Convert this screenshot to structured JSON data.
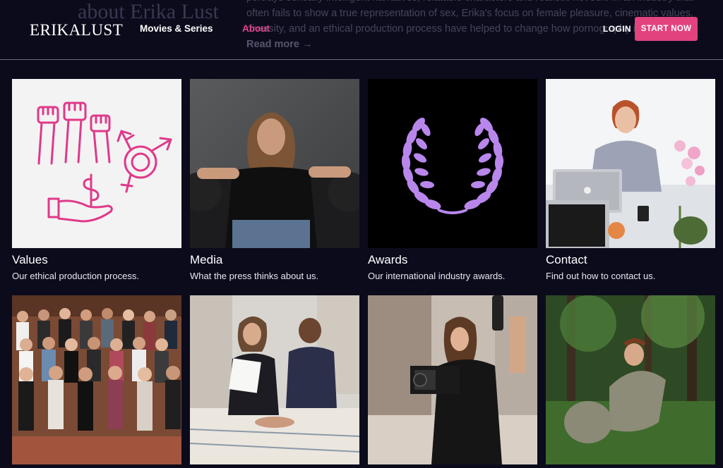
{
  "background_text": {
    "heading": "about Erika Lust",
    "paragraph": "portrays sexually intelligent narratives, relatable characters and realistic hot sex. In an industry that often fails to show a true representation of sex, Erika's focus on female pleasure, cinematic values, diversity, and an ethical production process have helped to change how pornography is consumed.",
    "read_more": "Read more →"
  },
  "header": {
    "logo": "ERIKALUST",
    "nav": [
      "Movies & Series",
      "About"
    ],
    "active_nav": "About",
    "login": "LOGIN",
    "cta": "START NOW"
  },
  "colors": {
    "background": "#0c0b1c",
    "accent": "#e2437f",
    "active_link": "#e5408c",
    "laurel": "#b987ec",
    "values_icons": "#e0398a"
  },
  "cards": [
    {
      "title": "Values",
      "subtitle": "Our ethical production process.",
      "image": "values-icons-illustration"
    },
    {
      "title": "Media",
      "subtitle": "What the press thinks about us.",
      "image": "woman-on-leather-sofa-photo"
    },
    {
      "title": "Awards",
      "subtitle": "Our international industry awards.",
      "image": "laurel-wreath-icon"
    },
    {
      "title": "Contact",
      "subtitle": "Find out how to contact us.",
      "image": "woman-at-laptop-photo"
    },
    {
      "image": "team-group-photo"
    },
    {
      "image": "two-people-on-bed-photo"
    },
    {
      "image": "camera-operator-photo"
    },
    {
      "image": "woman-in-forest-photo"
    }
  ]
}
